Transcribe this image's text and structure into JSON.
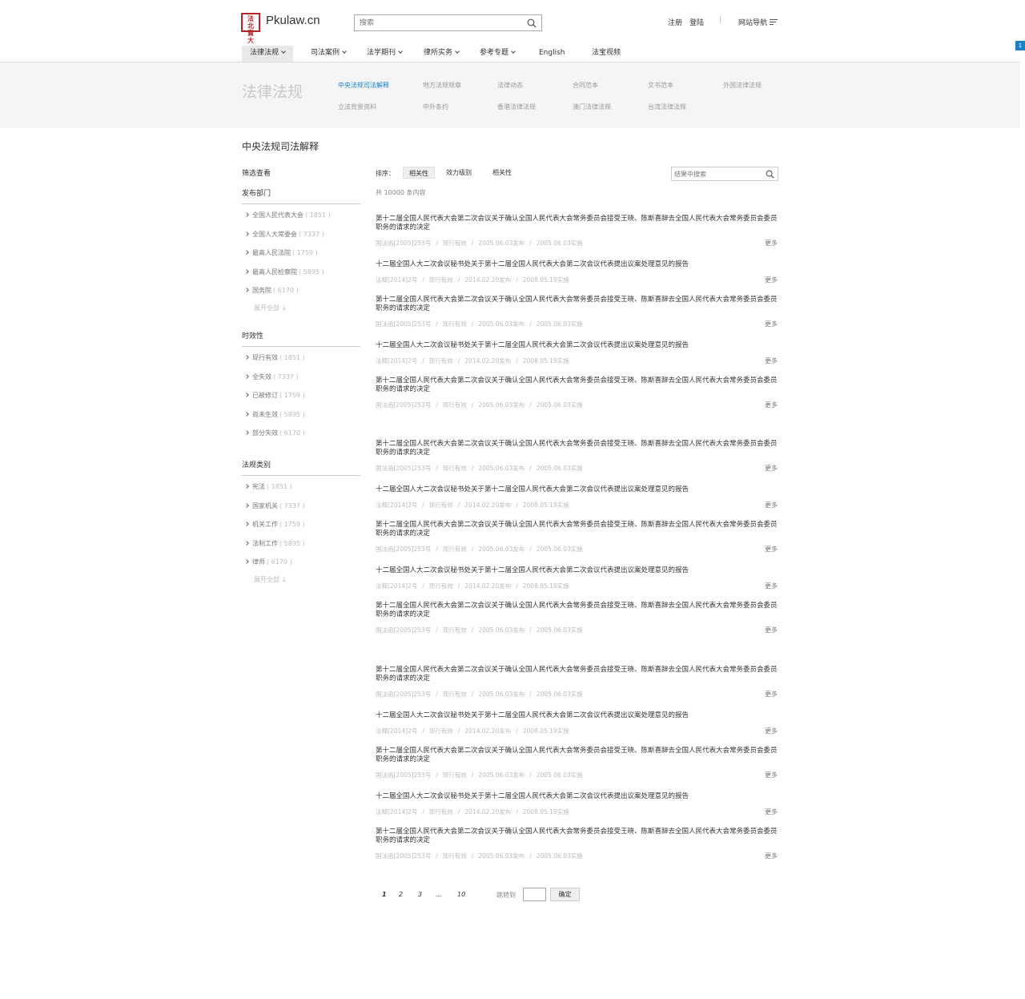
{
  "header": {
    "logo_chars": [
      "法",
      "北",
      "寶",
      "大"
    ],
    "site_name": "Pkulaw.cn",
    "search_placeholder": "搜索",
    "register": "注册",
    "login": "登陆",
    "separator": "|",
    "site_nav": "网站导航"
  },
  "nav": [
    {
      "label": "法律法规",
      "caret": true,
      "active": true
    },
    {
      "label": "司法案例",
      "caret": true
    },
    {
      "label": "法学期刊",
      "caret": true
    },
    {
      "label": "律所实务",
      "caret": true
    },
    {
      "label": "参考专题",
      "caret": true
    },
    {
      "label": "English",
      "caret": false
    },
    {
      "label": "法宝视频",
      "caret": false
    }
  ],
  "corner_badge": "1",
  "band": {
    "title": "法律法规",
    "row1": [
      "中央法规司法解释",
      "地方法规规章",
      "法律动态",
      "合同范本",
      "文书范本",
      "外国法律法规"
    ],
    "row2": [
      "立法背景资料",
      "中外条约",
      "香港法律法规",
      "澳门法律法规",
      "台湾法律法规"
    ],
    "active_index": 0
  },
  "page_title": "中央法规司法解释",
  "sidebar": {
    "heading": "筛选查看",
    "groups": [
      {
        "title": "发布部门",
        "items": [
          {
            "label": "全国人民代表大会",
            "count": "( 1851 )"
          },
          {
            "label": "全国人大常委会",
            "count": "( 7337 )"
          },
          {
            "label": "最高人民法院",
            "count": "( 1759 )"
          },
          {
            "label": "最高人民检察院",
            "count": "( 5895 )"
          },
          {
            "label": "国务院",
            "count": "( 6170 )"
          }
        ],
        "more": "展开全部 ↓"
      },
      {
        "title": "时效性",
        "items": [
          {
            "label": "现行有效",
            "count": "( 1851 )"
          },
          {
            "label": "全失效",
            "count": "( 7337 )"
          },
          {
            "label": "已被修订",
            "count": "( 1759 )"
          },
          {
            "label": "尚未生效",
            "count": "( 5895 )"
          },
          {
            "label": "部分失效",
            "count": "( 6170 )"
          }
        ]
      },
      {
        "title": "法规类别",
        "items": [
          {
            "label": "宪法",
            "count": "( 1851 )"
          },
          {
            "label": "国家机关",
            "count": "( 7337 )"
          },
          {
            "label": "机关工作",
            "count": "( 1759 )"
          },
          {
            "label": "法制工作",
            "count": "( 5895 )"
          },
          {
            "label": "律师",
            "count": "( 6170 )"
          }
        ],
        "more": "展开全部 ↓"
      }
    ]
  },
  "sort": {
    "label": "排序：",
    "options": [
      "相关性",
      "效力级别",
      "相关性"
    ],
    "active_index": 0,
    "result_search_placeholder": "结果中搜索",
    "total": "共 10000 条内容"
  },
  "templates": {
    "a": {
      "title": "第十二届全国人民代表大会第二次会议关于确认全国人民代表大会常务委员会接受王晓、陈斯喜辞去全国人民代表大会常务委员会委员职务的请求的决定",
      "meta": [
        "国法函[2005]253号",
        "现行有效",
        "2005.06.03发布",
        "2005.06.03实施"
      ]
    },
    "b": {
      "title": "十二届全国人大二次会议秘书处关于第十二届全国人民代表大会第二次会议代表提出议案处理意见的报告",
      "meta": [
        "法释[2014]2号",
        "现行有效",
        "2014.02.20发布",
        "2008.05.19实施"
      ]
    },
    "more": "更多"
  },
  "results": [
    "a",
    "b",
    "a",
    "b",
    "a",
    "a",
    "b",
    "a",
    "b",
    "a",
    "a",
    "b",
    "a",
    "b",
    "a"
  ],
  "pagination": {
    "pages": [
      "1",
      "2",
      "3",
      "...",
      "10"
    ],
    "current": "1",
    "jump_label": "跳转到",
    "ok": "确定"
  }
}
